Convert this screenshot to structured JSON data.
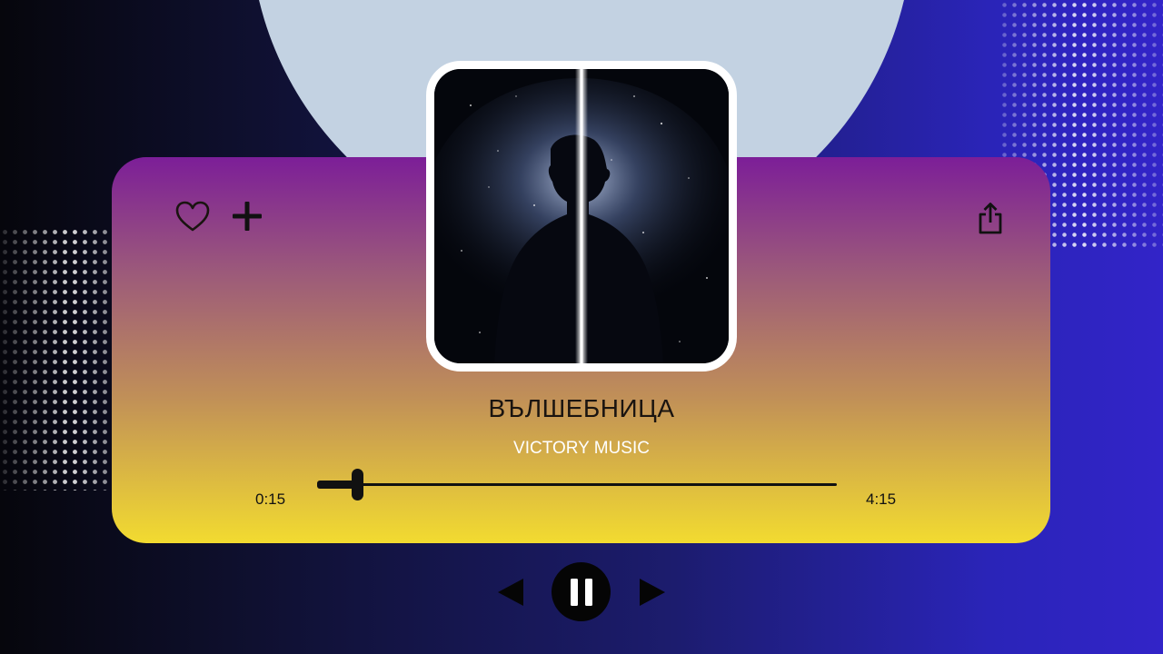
{
  "track": {
    "title": "ВЪЛШЕБНИЦА",
    "artist": "VICTORY MUSIC"
  },
  "playback": {
    "elapsed": "0:15",
    "duration": "4:15",
    "progress_fraction": 0.077,
    "state": "playing"
  },
  "actions": {
    "like_icon": "heart-icon",
    "add_icon": "plus-icon",
    "share_icon": "share-icon"
  },
  "controls": {
    "previous_icon": "previous-triangle-icon",
    "pause_icon": "pause-icon",
    "next_icon": "next-triangle-icon"
  },
  "colors": {
    "card_top": "#7c1e98",
    "card_bottom": "#f2db30",
    "halo": "#c3d2e2",
    "background_right": "#3224c8"
  }
}
